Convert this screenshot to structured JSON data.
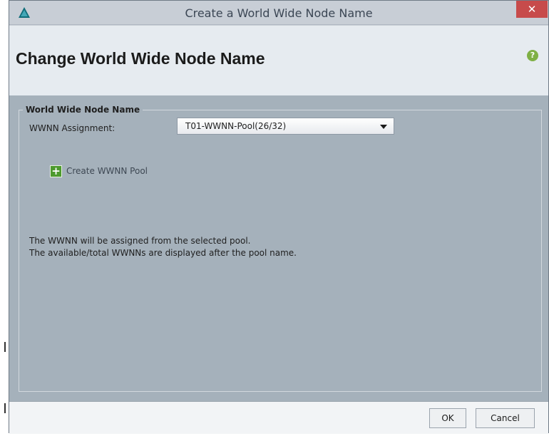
{
  "window": {
    "title": "Create a World Wide Node Name",
    "close_glyph": "✕"
  },
  "header": {
    "title": "Change World Wide Node Name",
    "help_glyph": "?"
  },
  "group": {
    "legend": "World Wide Node Name",
    "assignment_label": "WWNN Assignment:",
    "assignment_value": "T01-WWNN-Pool(26/32)",
    "create_link_label": "Create WWNN Pool",
    "info_lines": [
      "The WWNN will be assigned from the selected pool.",
      "The available/total WWNNs are displayed after the pool name."
    ]
  },
  "footer": {
    "ok_label": "OK",
    "cancel_label": "Cancel"
  },
  "colors": {
    "close_red": "#c74b4b",
    "plus_green": "#4d9a2e",
    "help_green": "#7fb045"
  },
  "icons": {
    "app": "app-logo-icon",
    "close": "close-icon",
    "help": "help-icon",
    "dropdown": "chevron-down-icon",
    "create": "plus-icon"
  }
}
